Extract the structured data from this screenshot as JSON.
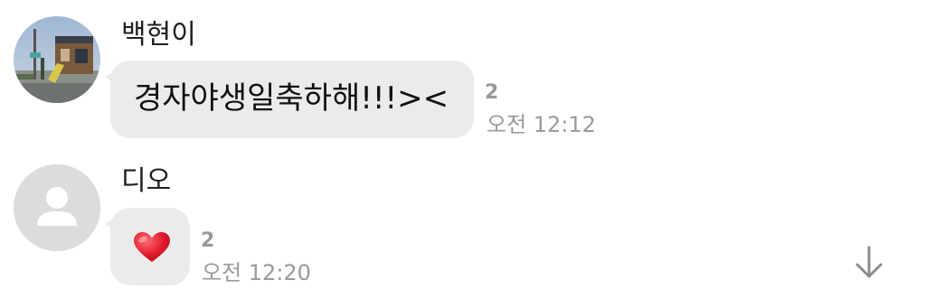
{
  "messages": [
    {
      "sender": "백현이",
      "text": "경자야생일축하해!!!><",
      "unread_count": "2",
      "time": "오전 12:12",
      "avatar": "photo-avatar"
    },
    {
      "sender": "디오",
      "content_icon": "heart-icon",
      "unread_count": "2",
      "time": "오전 12:20",
      "avatar": "default-person-avatar"
    }
  ],
  "controls": {
    "scroll_down_icon": "arrow-down-icon"
  },
  "colors": {
    "bubble": "#ebebeb",
    "meta_text": "#9a9a9a",
    "heart": "#e01a2b"
  }
}
